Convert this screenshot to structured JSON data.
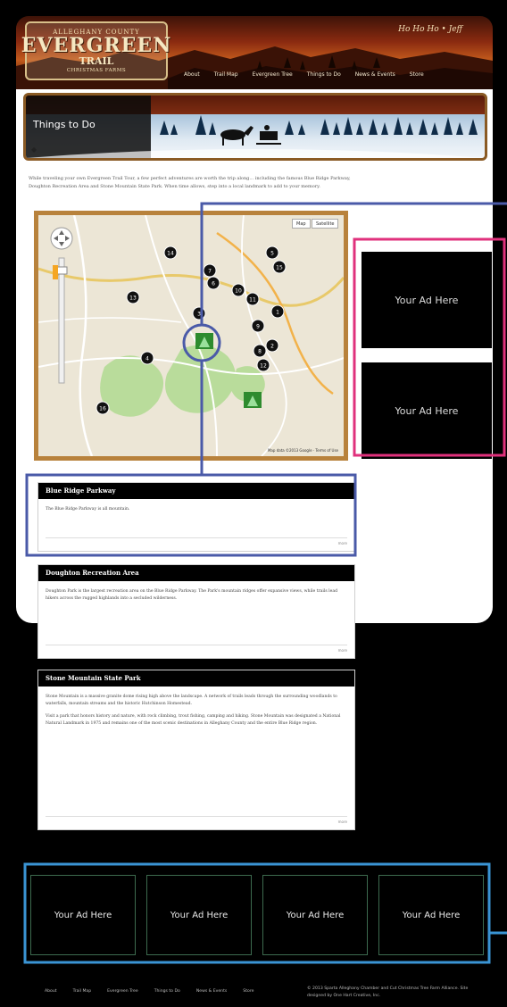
{
  "header": {
    "logo": {
      "top": "ALLEGHANY COUNTY",
      "main": "EVERGREEN",
      "sub": "TRAIL",
      "tag": "CHRISTMAS FARMS"
    },
    "signature": "Ho Ho Ho • Jeff",
    "nav": [
      "About",
      "Trail Map",
      "Evergreen Tree",
      "Things to Do",
      "News & Events",
      "Store"
    ]
  },
  "banner": {
    "title": "Things to Do"
  },
  "intro": "While traveling your own Evergreen Trail Tour, a few perfect adventures are worth the trip along... including the famous Blue Ridge Parkway, Doughton Recreation Area and Stone Mountain State Park. When time allows, step into a local landmark to add to your memory.",
  "map": {
    "buttons": [
      "Map",
      "Satellite"
    ],
    "credit": "Map data ©2013 Google · Terms of Use",
    "markers": [
      {
        "label": "14"
      },
      {
        "label": "7"
      },
      {
        "label": "5"
      },
      {
        "label": "15"
      },
      {
        "label": "13"
      },
      {
        "label": "3"
      },
      {
        "label": "6"
      },
      {
        "label": "10"
      },
      {
        "label": "11"
      },
      {
        "label": "9"
      },
      {
        "label": "1"
      },
      {
        "label": "8"
      },
      {
        "label": "12"
      },
      {
        "label": "2"
      },
      {
        "label": "4"
      },
      {
        "label": "16"
      }
    ]
  },
  "cards": [
    {
      "title": "Blue Ridge Parkway",
      "paragraphs": [
        "The Blue Ridge Parkway is all mountain."
      ],
      "more": "more"
    },
    {
      "title": "Doughton Recreation Area",
      "paragraphs": [
        "Doughton Park is the largest recreation area on the Blue Ridge Parkway. The Park's mountain ridges offer expansive views, while trails lead hikers across the rugged highlands into a secluded wilderness."
      ],
      "more": "more"
    },
    {
      "title": "Stone Mountain State Park",
      "paragraphs": [
        "Stone Mountain is a massive granite dome rising high above the landscape. A network of trails leads through the surrounding woodlands to waterfalls, mountain streams and the historic Hutchinson Homestead.",
        "Visit a park that honors history and nature, with rock climbing, trout fishing, camping and hiking. Stone Mountain was designated a National Natural Landmark in 1975 and remains one of the most scenic destinations in Alleghany County and the entire Blue Ridge region."
      ],
      "more": "more"
    }
  ],
  "side_ads": [
    "Your Ad Here",
    "Your Ad Here"
  ],
  "bottom_ads": [
    "Your Ad Here",
    "Your Ad Here",
    "Your Ad Here",
    "Your Ad Here"
  ],
  "footer": {
    "nav": [
      "About",
      "Trail Map",
      "Evergreen Tree",
      "Things to Do",
      "News & Events",
      "Store"
    ],
    "copy": "© 2013 Sparta Alleghany Chamber and Cut Christmas Tree Farm Alliance. Site designed by One Hart Creative, Inc."
  },
  "colors": {
    "annotation_blue": "#4a5aa8",
    "annotation_pink": "#e0317c",
    "annotation_light_blue": "#3a94d4",
    "frame_gold": "#b8823c"
  }
}
